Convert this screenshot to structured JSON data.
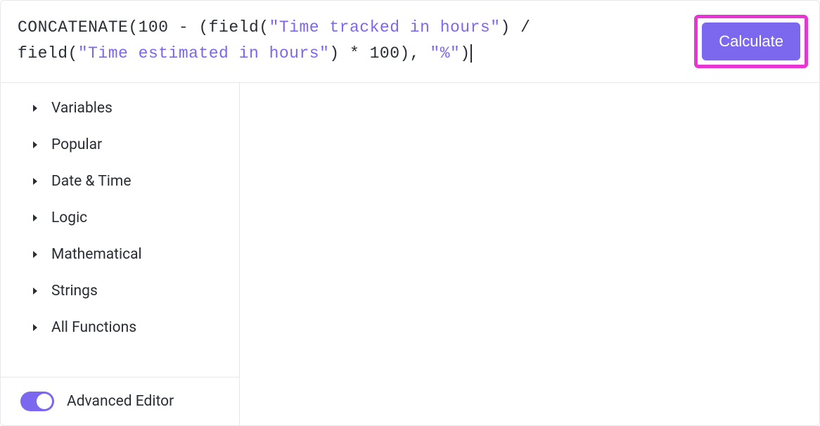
{
  "formula": {
    "tokens": [
      {
        "text": "CONCATENATE(100 - (field(",
        "class": "func"
      },
      {
        "text": "\"Time tracked in hours\"",
        "class": "field-name"
      },
      {
        "text": ") / ",
        "class": "func"
      },
      {
        "text": "field(",
        "class": "func",
        "break_before": true
      },
      {
        "text": "\"Time estimated in hours\"",
        "class": "field-name"
      },
      {
        "text": ") * 100), ",
        "class": "func"
      },
      {
        "text": "\"%\"",
        "class": "field-name"
      },
      {
        "text": ")",
        "class": "func"
      }
    ]
  },
  "buttons": {
    "calculate": "Calculate"
  },
  "sidebar": {
    "categories": [
      {
        "label": "Variables"
      },
      {
        "label": "Popular"
      },
      {
        "label": "Date & Time"
      },
      {
        "label": "Logic"
      },
      {
        "label": "Mathematical"
      },
      {
        "label": "Strings"
      },
      {
        "label": "All Functions"
      }
    ],
    "advanced_editor_label": "Advanced Editor",
    "advanced_editor_on": true
  }
}
